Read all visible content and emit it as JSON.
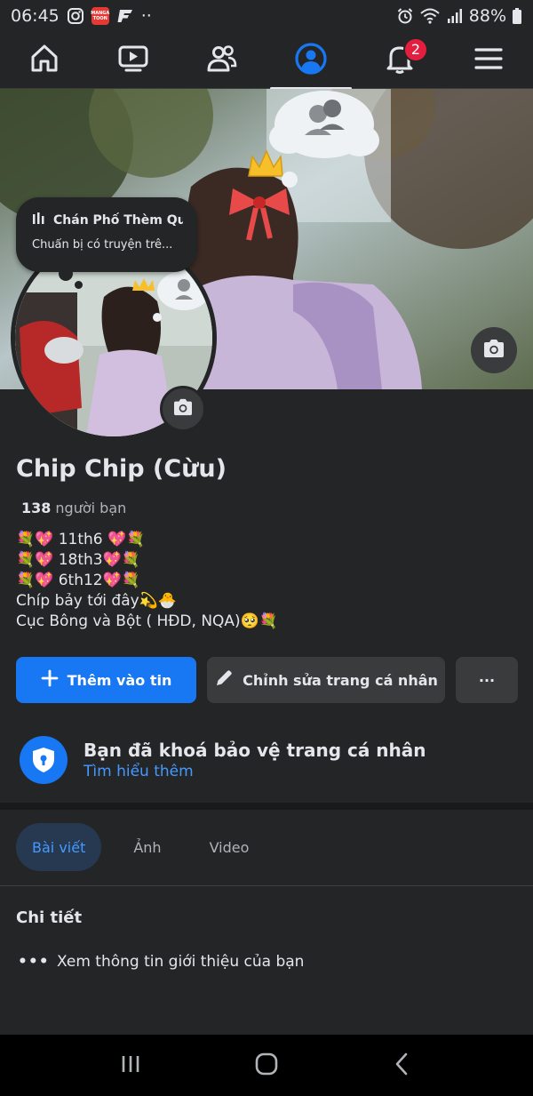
{
  "status_bar": {
    "time": "06:45",
    "app_badge_text": "MANGA TOON",
    "overflow": "··",
    "battery_percent": "88%"
  },
  "top_nav": {
    "items": [
      {
        "name": "home",
        "icon": "home-icon",
        "active": false
      },
      {
        "name": "watch",
        "icon": "video-icon",
        "active": false
      },
      {
        "name": "friends",
        "icon": "friends-icon",
        "active": false
      },
      {
        "name": "profile",
        "icon": "profile-icon",
        "active": true
      },
      {
        "name": "notifications",
        "icon": "bell-icon",
        "active": false
      },
      {
        "name": "menu",
        "icon": "hamburger-menu-icon",
        "active": false
      }
    ],
    "notification_count": "2"
  },
  "note": {
    "title": "Chán Phố Thèm Qu...",
    "subtitle": "Chuẩn bị có truyện trê..."
  },
  "profile": {
    "name": "Chip Chip (Cừu)",
    "friends_count": "138",
    "friends_label": "người bạn",
    "bio": [
      "💐💖 11th6 💖💐",
      "💐💖 18th3💖💐",
      "💐💖 6th12💖💐",
      "Chíp bảy tới đây💫🐣",
      "Cục Bông và Bột ( HĐD, NQA)🥺💐"
    ]
  },
  "actions": {
    "add_story": "Thêm vào tin",
    "edit_profile": "Chỉnh sửa trang cá nhân",
    "more": "···"
  },
  "profile_lock": {
    "title": "Bạn đã khoá bảo vệ trang cá nhân",
    "link": "Tìm hiểu thêm"
  },
  "tabs": [
    {
      "label": "Bài viết",
      "active": true
    },
    {
      "label": "Ảnh",
      "active": false
    },
    {
      "label": "Video",
      "active": false
    }
  ],
  "details": {
    "title": "Chi tiết",
    "dots": "•••",
    "intro_link": "Xem thông tin giới thiệu của bạn"
  },
  "colors": {
    "background": "#242526",
    "accent": "#1877f2",
    "link": "#4599ff",
    "badge": "#e41e3f"
  }
}
